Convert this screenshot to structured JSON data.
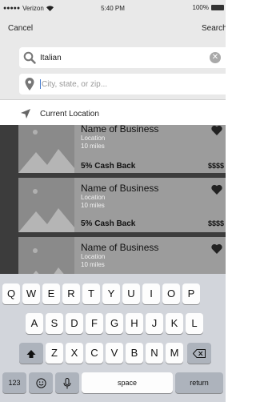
{
  "status_bar": {
    "signal": "●●●●●",
    "carrier": "Verizon",
    "time": "5:40 PM",
    "battery": "100%"
  },
  "header": {
    "cancel_label": "Cancel",
    "search_label": "Search"
  },
  "query_field": {
    "value": "Italian",
    "icon": "search-icon",
    "clear_icon": "clear-icon"
  },
  "location_field": {
    "placeholder": "City, state, or zip...",
    "icon": "location-pin-icon"
  },
  "current_location": {
    "label": "Current Location",
    "icon": "navigation-arrow-icon"
  },
  "results": [
    {
      "name": "Name of Business",
      "location": "Location",
      "distance": "10 miles",
      "cashback": "5% Cash Back",
      "price": "$$$$"
    },
    {
      "name": "Name of Business",
      "location": "Location",
      "distance": "10 miles",
      "cashback": "5% Cash Back",
      "price": "$$$$"
    },
    {
      "name": "Name of Business",
      "location": "Location",
      "distance": "10 miles",
      "cashback": "",
      "price": ""
    }
  ],
  "keyboard": {
    "row1": [
      "Q",
      "W",
      "E",
      "R",
      "T",
      "Y",
      "U",
      "I",
      "O",
      "P"
    ],
    "row2": [
      "A",
      "S",
      "D",
      "F",
      "G",
      "H",
      "J",
      "K",
      "L"
    ],
    "row3": [
      "Z",
      "X",
      "C",
      "V",
      "B",
      "N",
      "M"
    ],
    "numbers_label": "123",
    "space_label": "space",
    "return_label": "return"
  },
  "colors": {
    "header_bg": "#e9e9e9",
    "results_bg": "#3c3c3c",
    "card_bg": "#9c9c9c",
    "keyboard_bg": "#d2d5db",
    "caret": "#4a7fd0"
  }
}
